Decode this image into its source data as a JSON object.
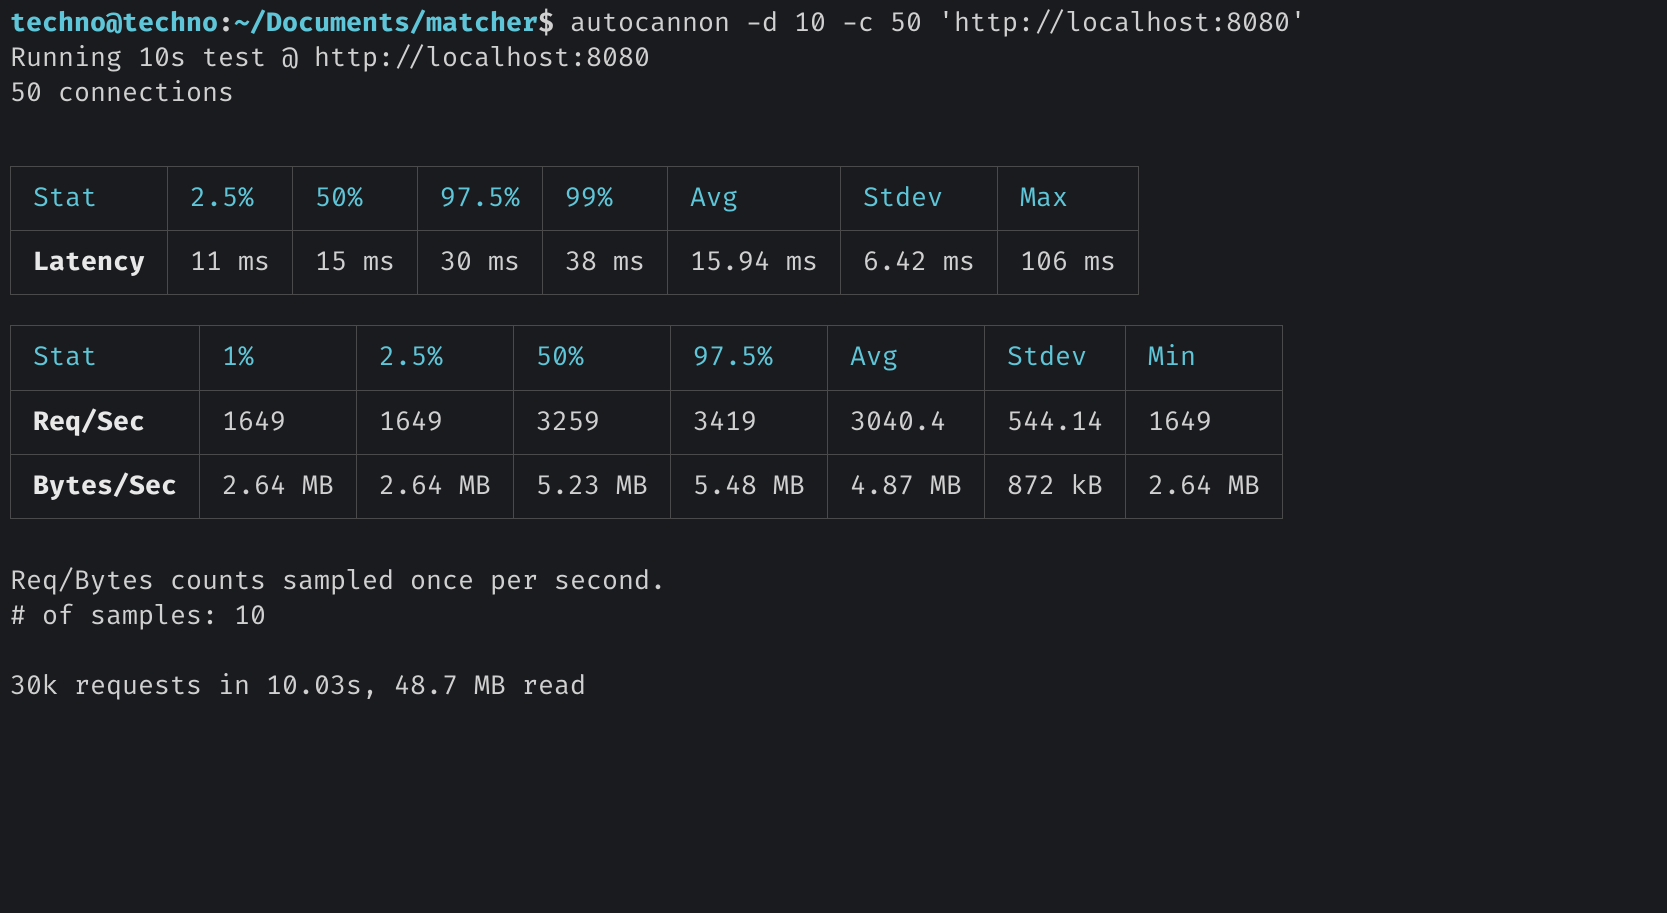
{
  "prompt": {
    "user": "techno@techno",
    "sep1": ":",
    "path": "~/Documents/matcher",
    "sep2": "$",
    "command": " autocannon -d 10 -c 50 'http://localhost:8080'"
  },
  "lines": {
    "running": "Running 10s test @ http://localhost:8080",
    "connections": "50 connections"
  },
  "latency_table": {
    "headers": [
      "Stat",
      "2.5%",
      "50%",
      "97.5%",
      "99%",
      "Avg",
      "Stdev",
      "Max"
    ],
    "row_label": "Latency",
    "row": [
      "11 ms",
      "15 ms",
      "30 ms",
      "38 ms",
      "15.94 ms",
      "6.42 ms",
      "106 ms"
    ]
  },
  "throughput_table": {
    "headers": [
      "Stat",
      "1%",
      "2.5%",
      "50%",
      "97.5%",
      "Avg",
      "Stdev",
      "Min"
    ],
    "rows": [
      {
        "label": "Req/Sec",
        "cells": [
          "1649",
          "1649",
          "3259",
          "3419",
          "3040.4",
          "544.14",
          "1649"
        ]
      },
      {
        "label": "Bytes/Sec",
        "cells": [
          "2.64 MB",
          "2.64 MB",
          "5.23 MB",
          "5.48 MB",
          "4.87 MB",
          "872 kB",
          "2.64 MB"
        ]
      }
    ]
  },
  "footer": {
    "l1": "Req/Bytes counts sampled once per second.",
    "l2": "# of samples: 10",
    "l3": "30k requests in 10.03s, 48.7 MB read"
  }
}
